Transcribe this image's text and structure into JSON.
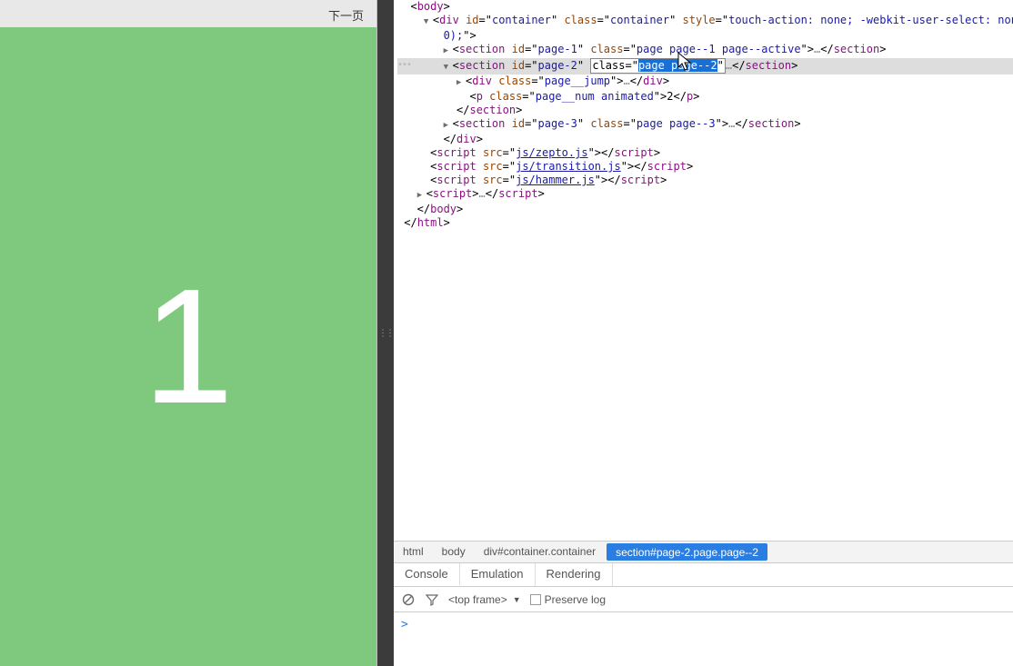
{
  "preview": {
    "next_label": "下一页",
    "page_number": "1",
    "page_bg": "#7ec97e"
  },
  "tree": {
    "body_tag": "body",
    "container": {
      "tag": "div",
      "id": "container",
      "class": "container",
      "style_snip": "touch-action: none; -webkit-user-select: none; -webki",
      "style_tail": "0);"
    },
    "page1": {
      "tag": "section",
      "id": "page-1",
      "class": "page page--1 page--active"
    },
    "page2": {
      "tag": "section",
      "id": "page-2",
      "class_field_label": "class=",
      "class_editing": "page page--2",
      "jump": {
        "tag": "div",
        "class": "page__jump"
      },
      "pnum": {
        "tag": "p",
        "class": "page__num animated",
        "text": "2"
      }
    },
    "page3": {
      "tag": "section",
      "id": "page-3",
      "class": "page page--3"
    },
    "scripts": [
      {
        "src": "js/zepto.js"
      },
      {
        "src": "js/transition.js"
      },
      {
        "src": "js/hammer.js"
      }
    ]
  },
  "crumbs": {
    "c1": "html",
    "c2": "body",
    "c3": "div#container.container",
    "c4": "section#page-2.page.page--2"
  },
  "subtabs": {
    "console": "Console",
    "emulation": "Emulation",
    "rendering": "Rendering"
  },
  "toolbar": {
    "top_frame": "<top frame>",
    "preserve_log": "Preserve log"
  },
  "console_prompt": ">"
}
